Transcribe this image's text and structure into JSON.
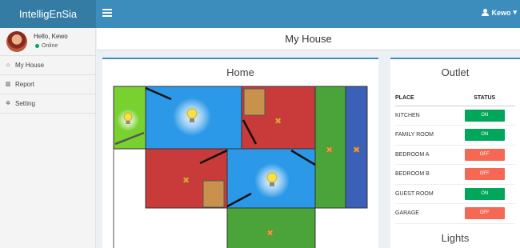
{
  "app": {
    "title": "IntelligEnSia"
  },
  "header": {
    "user_name": "Kewo"
  },
  "sidebar": {
    "greeting": "Hello, Kewo",
    "status": "Online",
    "items": [
      {
        "label": "My House",
        "icon": "home-icon"
      },
      {
        "label": "Report",
        "icon": "chart-icon"
      },
      {
        "label": "Setting",
        "icon": "gear-icon"
      }
    ]
  },
  "page": {
    "title": "My House"
  },
  "home": {
    "title": "Home"
  },
  "outlet": {
    "title": "Outlet",
    "headers": {
      "place": "PLACE",
      "status": "STATUS"
    },
    "rows": [
      {
        "place": "KITCHEN",
        "status": "ON"
      },
      {
        "place": "FAMILY ROOM",
        "status": "ON"
      },
      {
        "place": "BEDROOM A",
        "status": "OFF"
      },
      {
        "place": "BEDROOM B",
        "status": "OFF"
      },
      {
        "place": "GUEST ROOM",
        "status": "ON"
      },
      {
        "place": "GARAGE",
        "status": "OFF"
      }
    ]
  },
  "lights": {
    "title": "Lights"
  },
  "colors": {
    "accent": "#3c8dbc",
    "on": "#00a65a",
    "off": "#f56954"
  }
}
